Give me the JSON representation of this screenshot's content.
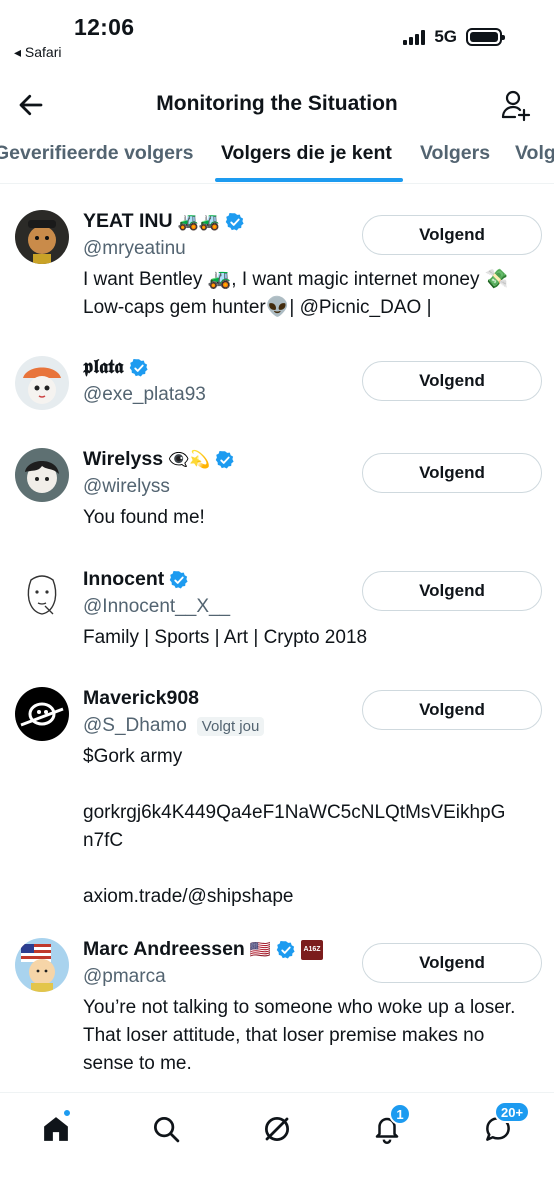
{
  "status_bar": {
    "time": "12:06",
    "back_app": "◂ Safari",
    "network": "5G"
  },
  "header": {
    "title": "Monitoring the Situation"
  },
  "tabs": [
    {
      "label": "Geverifieerde volgers"
    },
    {
      "label": "Volgers die je kent"
    },
    {
      "label": "Volgers"
    },
    {
      "label": "Volg"
    }
  ],
  "users": [
    {
      "name": "YEAT INU",
      "name_emoji": "🚜🚜",
      "handle": "@mryeatinu",
      "bio": "I want Bentley 🚜, I want magic internet money 💸 Low-caps gem hunter👽| @Picnic_DAO |",
      "button": "Volgend"
    },
    {
      "name": "𝖕𝖑𝖆𝖙𝖆",
      "name_emoji": "",
      "handle": "@exe_plata93",
      "bio": "",
      "button": "Volgend"
    },
    {
      "name": "Wirelyss",
      "name_emoji": "👁️‍🗨️💫",
      "handle": "@wirelyss",
      "bio": "You found me!",
      "button": "Volgend"
    },
    {
      "name": "Innocent",
      "name_emoji": "",
      "handle": "@Innocent__X__",
      "bio": "Family | Sports | Art | Crypto 2018",
      "button": "Volgend"
    },
    {
      "name": "Maverick908",
      "name_emoji": "",
      "handle": "@S_Dhamo",
      "follows_you": "Volgt jou",
      "bio": "$Gork army\n\ngorkrgj6k4K449Qa4eF1NaWC5cNLQtMsVEikhpG\nn7fC\n\naxiom.trade/@shipshape",
      "button": "Volgend"
    },
    {
      "name": "Marc Andreessen",
      "name_emoji": "🇺🇸",
      "affiliate_badge": "A16Z",
      "handle": "@pmarca",
      "bio": "You’re not talking to someone who woke up a loser. That loser attitude, that loser premise makes no sense to me.",
      "button": "Volgend"
    }
  ],
  "bottom_nav": {
    "notifications_badge": "1",
    "messages_badge": "20+"
  },
  "colors": {
    "accent": "#1d9bf0",
    "text": "#0f1419",
    "secondary": "#536471"
  }
}
